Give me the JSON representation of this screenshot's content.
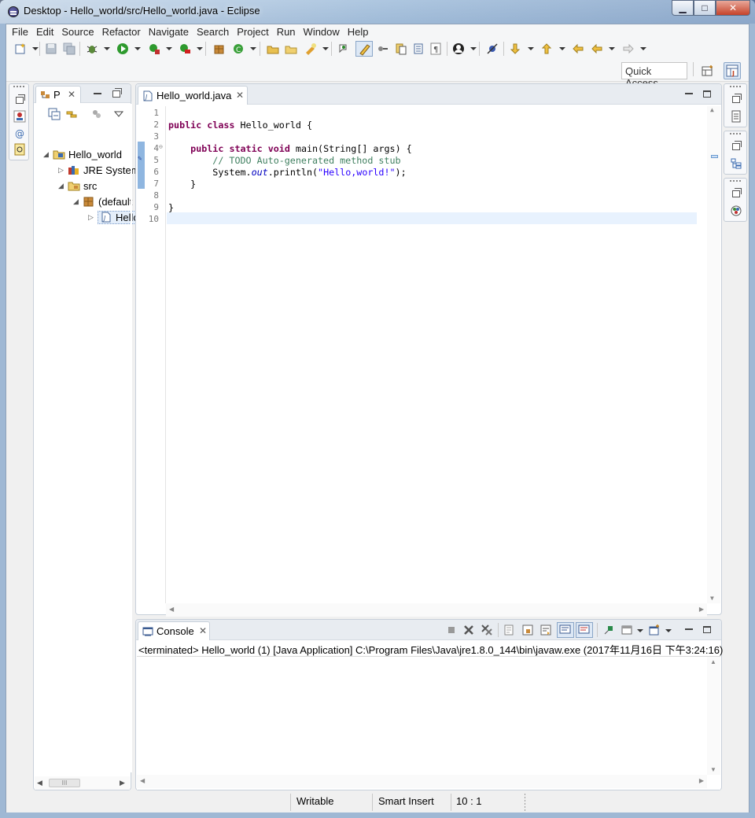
{
  "window": {
    "title": "Desktop - Hello_world/src/Hello_world.java - Eclipse",
    "buttons": {
      "minimize": "▁",
      "maximize": "□",
      "close": "✕"
    }
  },
  "menu": [
    "File",
    "Edit",
    "Source",
    "Refactor",
    "Navigate",
    "Search",
    "Project",
    "Run",
    "Window",
    "Help"
  ],
  "quick_access": {
    "label": "Quick Access"
  },
  "package_explorer": {
    "tab_label": "P",
    "tree": [
      {
        "label": "Hello_world",
        "icon": "project-icon",
        "expanded": true
      },
      {
        "label": "JRE System Library",
        "icon": "library-icon",
        "expanded": false
      },
      {
        "label": "src",
        "icon": "source-folder-icon",
        "expanded": true
      },
      {
        "label": "(default package)",
        "icon": "package-icon",
        "expanded": true
      },
      {
        "label": "Hello_world.java",
        "icon": "java-file-icon",
        "expanded": false,
        "selected": true
      }
    ]
  },
  "editor": {
    "tab_label": "Hello_world.java",
    "line_numbers": [
      "1",
      "2",
      "3",
      "4",
      "5",
      "6",
      "7",
      "8",
      "9",
      "10"
    ],
    "lines": {
      "l2": {
        "kw1": "public",
        "kw2": "class",
        "rest": " Hello_world {"
      },
      "l4": {
        "kw1": "public",
        "kw2": "static",
        "kw3": "void",
        "rest": " main(String[] args) {"
      },
      "l5": {
        "comment": "// TODO Auto-generated method stub"
      },
      "l6": {
        "before": "System.",
        "field": "out",
        "middle": ".println(",
        "string": "\"Hello,world!\"",
        "after": ");"
      },
      "l7": {
        "text": "}"
      },
      "l9": {
        "text": "}"
      }
    }
  },
  "console": {
    "tab_label": "Console",
    "description": "<terminated> Hello_world (1) [Java Application] C:\\Program Files\\Java\\jre1.8.0_144\\bin\\javaw.exe (2017年11月16日 下午3:24:16)"
  },
  "status": {
    "writable": "Writable",
    "insert_mode": "Smart Insert",
    "position": "10 : 1"
  },
  "colors": {
    "keyword": "#7f0055",
    "comment": "#3f7f5f",
    "string": "#2a00ff",
    "field": "#0000c0",
    "current_line": "#e8f2fe"
  }
}
